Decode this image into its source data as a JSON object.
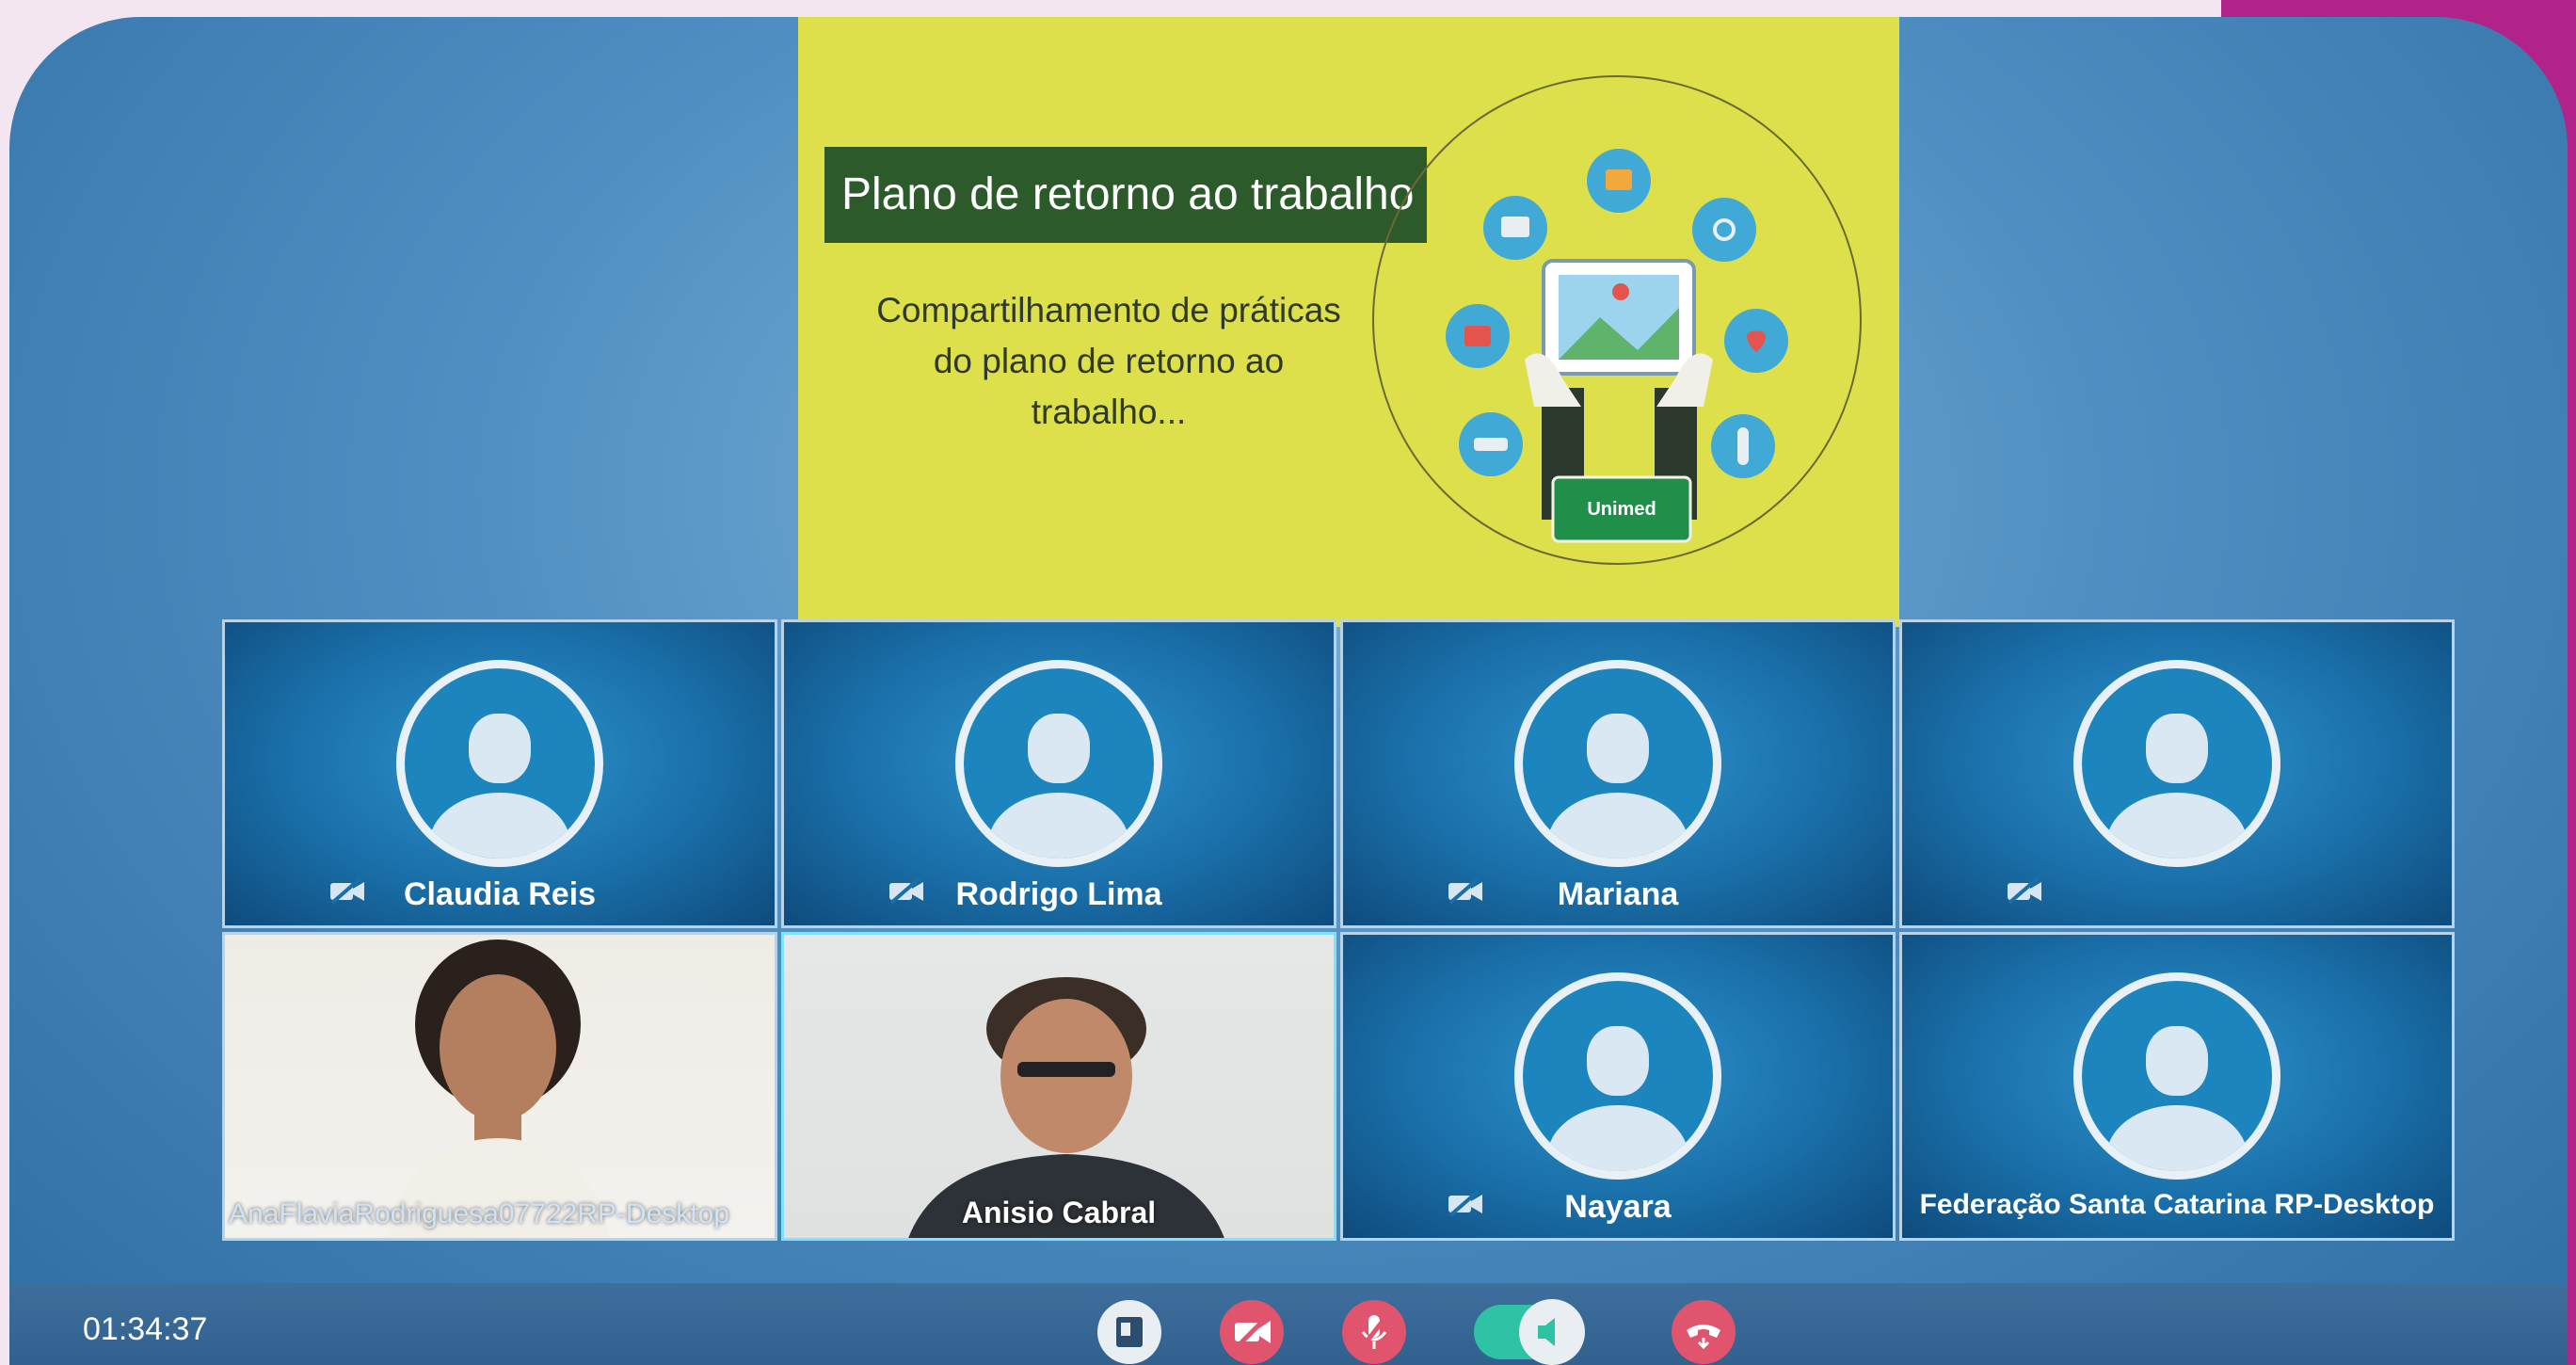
{
  "slide": {
    "title": "Plano de retorno ao trabalho",
    "subtitle": "Compartilhamento de práticas\ndo plano de retorno ao\ntrabalho...",
    "logo_text": "Unimed"
  },
  "participants": [
    {
      "name": "Claudia Reis",
      "video": false
    },
    {
      "name": "Rodrigo Lima",
      "video": false
    },
    {
      "name": "Mariana",
      "video": false
    },
    {
      "name": "",
      "video": false
    },
    {
      "name": "AnaFlaviaRodriguesa07722RP-Desktop",
      "video": true
    },
    {
      "name": "Anisio Cabral",
      "video": true,
      "active": true
    },
    {
      "name": "Nayara",
      "video": false
    },
    {
      "name": "Federação Santa Catarina RP-Desktop",
      "video": false
    }
  ],
  "toolbar": {
    "timer": "01:34:37",
    "share_icon": "share-screen-icon",
    "camera_icon": "camera-off-icon",
    "mic_icon": "mic-off-icon",
    "volume_icon": "volume-icon",
    "hangup_icon": "hang-up-icon"
  },
  "colors": {
    "slide_bg": "#dde04b",
    "title_bar": "#2d5a2b",
    "tile_blue": "#1a6fa9",
    "danger": "#e0546e",
    "toggle_green": "#2fc3a5"
  }
}
